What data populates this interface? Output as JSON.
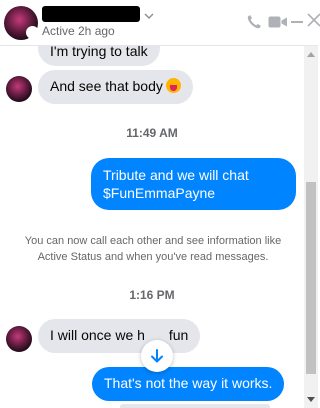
{
  "header": {
    "status": "Active 2h ago"
  },
  "messages": [
    {
      "text": "I'm trying to talk"
    },
    {
      "text": "And see that body"
    },
    {
      "text_line1": "Tribute and we will chat",
      "text_line2": "$FunEmmaPayne"
    },
    {
      "text_a": "I will once we h",
      "text_b": " fun"
    },
    {
      "text": "That's not the way it works."
    }
  ],
  "timestamps": [
    "11:49 AM",
    "1:16 PM"
  ],
  "notice": "You can now call each other and see information like Active Status and when you've read messages.",
  "icons": [
    "phone-icon",
    "video-icon",
    "minimize-icon",
    "close-icon",
    "arrow-down-icon",
    "tongue-emoji-icon"
  ],
  "colors": {
    "outgoing": "#0084ff",
    "incoming": "#e4e6eb",
    "icons": "#aeb1b6"
  }
}
